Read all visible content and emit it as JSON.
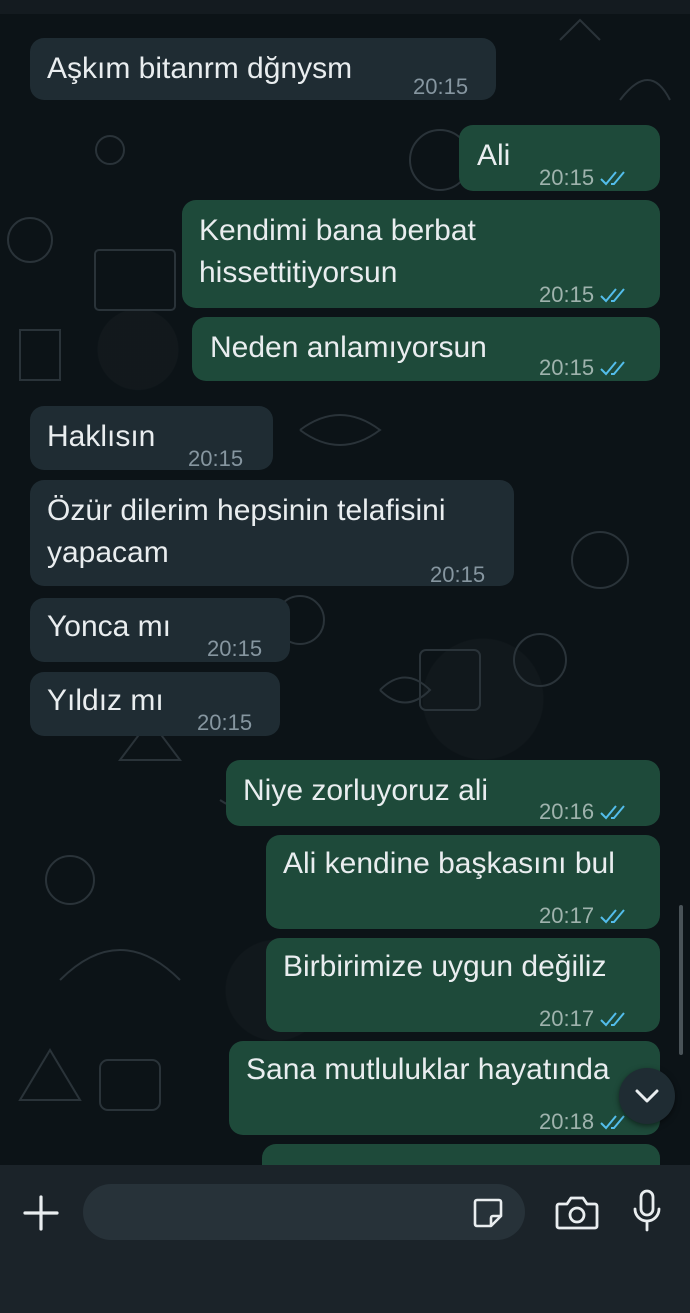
{
  "messages": [
    {
      "dir": "in",
      "text": "Aşkım bitanrm dğnysm",
      "time": "20:15"
    },
    {
      "dir": "out",
      "text": "Ali",
      "time": "20:15",
      "read": true
    },
    {
      "dir": "out",
      "text": "Kendimi bana berbat\nhissettitiyorsun",
      "time": "20:15",
      "read": true
    },
    {
      "dir": "out",
      "text": "Neden anlamıyorsun",
      "time": "20:15",
      "read": true
    },
    {
      "dir": "in",
      "text": "Haklısın",
      "time": "20:15"
    },
    {
      "dir": "in",
      "text": "Özür dilerim hepsinin telafisini\nyapacam",
      "time": "20:15"
    },
    {
      "dir": "in",
      "text": "Yonca mı",
      "time": "20:15"
    },
    {
      "dir": "in",
      "text": "Yıldız mı",
      "time": "20:15"
    },
    {
      "dir": "out",
      "text": "Niye zorluyoruz ali",
      "time": "20:16",
      "read": true
    },
    {
      "dir": "out",
      "text": "Ali kendine başkasını bul",
      "time": "20:17",
      "read": true
    },
    {
      "dir": "out",
      "text": "Birbirimize uygun değiliz",
      "time": "20:17",
      "read": true
    },
    {
      "dir": "out",
      "text": "Sana mutluluklar hayatında",
      "time": "20:18",
      "read": true
    }
  ],
  "composer": {
    "plus_icon": "plus-icon",
    "sticker_icon": "sticker-icon",
    "camera_icon": "camera-icon",
    "mic_icon": "microphone-icon"
  },
  "colors": {
    "incoming": "#1f2c33",
    "outgoing": "#1e4a3a",
    "read_ticks": "#53bdeb",
    "background": "#0c1317"
  }
}
